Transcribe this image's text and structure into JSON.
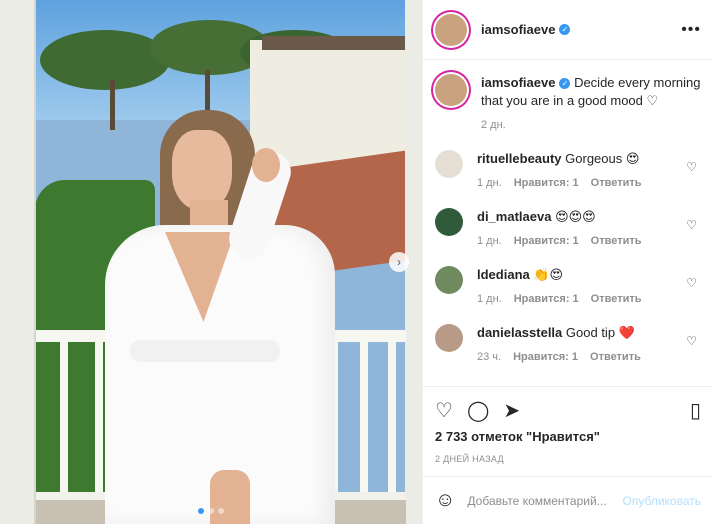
{
  "post": {
    "author": "iamsofiaeve",
    "more_icon": "more-horizontal-icon",
    "caption": "Decide every morning that you are in a good mood ♡",
    "caption_time": "2 дн."
  },
  "comments": [
    {
      "user": "rituellebeauty",
      "text": "Gorgeous 😍",
      "time": "1 дн.",
      "likes": "Нравится: 1",
      "reply": "Ответить"
    },
    {
      "user": "di_matlaeva",
      "text": "😍😍😍",
      "time": "1 дн.",
      "likes": "Нравится: 1",
      "reply": "Ответить"
    },
    {
      "user": "ldediana",
      "text": "👏😍",
      "time": "1 дн.",
      "likes": "Нравится: 1",
      "reply": "Ответить"
    },
    {
      "user": "danielasstella",
      "text": "Good tip ❤️",
      "time": "23 ч.",
      "likes": "Нравится: 1",
      "reply": "Ответить"
    }
  ],
  "actions": {
    "like_icon": "heart-icon",
    "comment_icon": "comment-icon",
    "share_icon": "share-icon",
    "save_icon": "bookmark-icon",
    "likes_count": "2 733 отметок \"Нравится\"",
    "date": "2 ДНЕЙ НАЗАД"
  },
  "composer": {
    "placeholder": "Добавьте комментарий...",
    "publish_label": "Опубликовать",
    "emoji_icon": "smile-icon"
  },
  "carousel": {
    "slides": 3,
    "active_index": 0
  },
  "colors": {
    "verified": "#3897f0",
    "link_disabled": "#b2dffc",
    "meta": "#8e8e8e",
    "like_red": "#ed4956"
  }
}
